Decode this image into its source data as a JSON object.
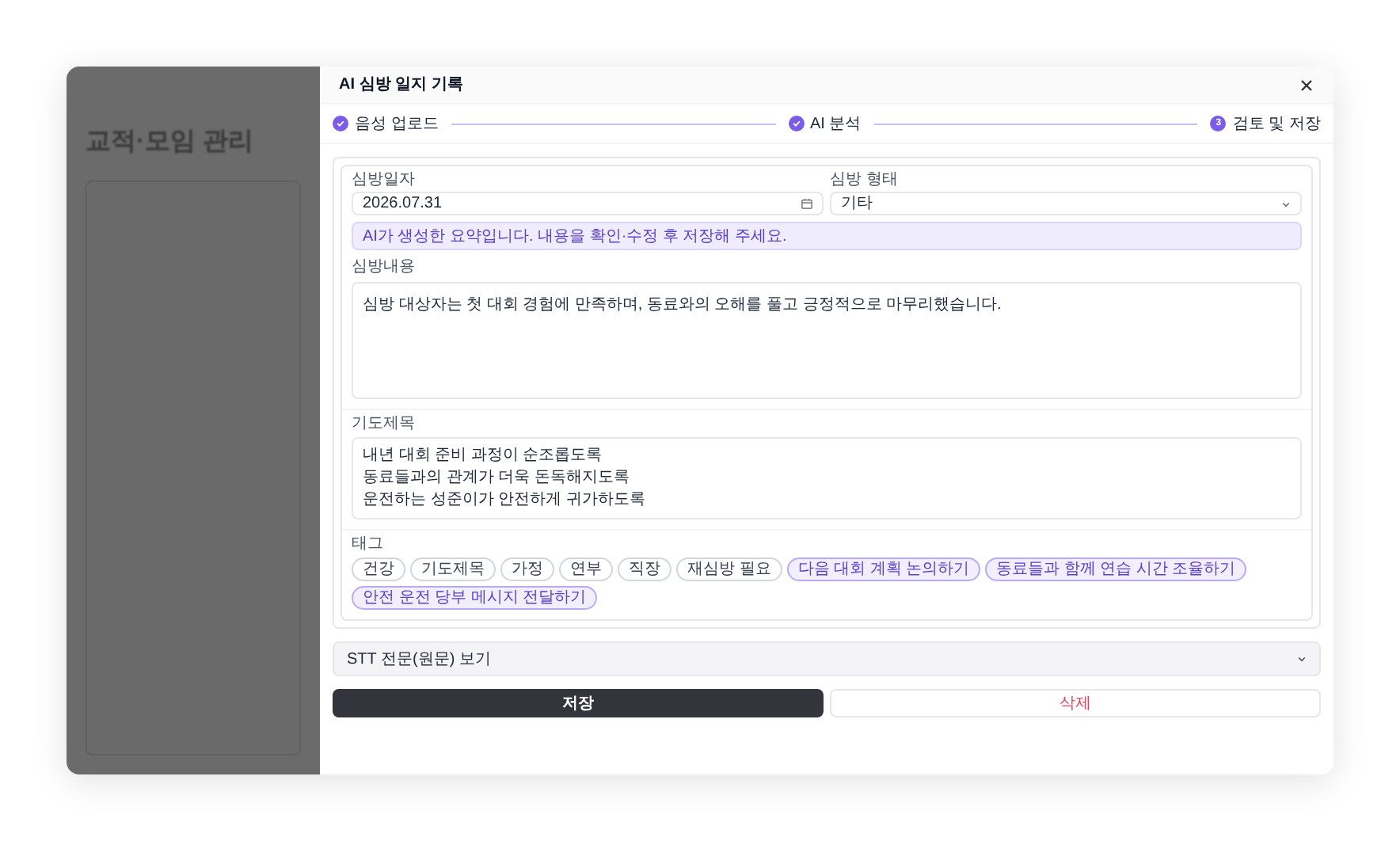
{
  "background_page": {
    "title": "교적·모임 관리"
  },
  "dialog": {
    "title": "AI 심방 일지 기록",
    "steps": [
      {
        "label": "음성 업로드",
        "done": true
      },
      {
        "label": "AI 분석",
        "done": true
      },
      {
        "label": "검토 및 저장",
        "done": false,
        "number": "3"
      }
    ],
    "date_field": {
      "label": "심방일자",
      "value": "2026.07.31"
    },
    "type_field": {
      "label": "심방 형태",
      "value": "기타"
    },
    "notice": "AI가 생성한 요약입니다. 내용을 확인·수정 후 저장해 주세요.",
    "content_field": {
      "label": "심방내용",
      "value": "심방 대상자는 첫 대회 경험에 만족하며, 동료와의 오해를 풀고 긍정적으로 마무리했습니다."
    },
    "prayer_field": {
      "label": "기도제목",
      "lines": [
        "내년 대회 준비 과정이 순조롭도록",
        "동료들과의 관계가 더욱 돈독해지도록",
        "운전하는 성준이가 안전하게 귀가하도록"
      ]
    },
    "tags": {
      "label": "태그",
      "items": [
        {
          "label": "건강",
          "selected": false
        },
        {
          "label": "기도제목",
          "selected": false
        },
        {
          "label": "가정",
          "selected": false
        },
        {
          "label": "연부",
          "selected": false
        },
        {
          "label": "직장",
          "selected": false
        },
        {
          "label": "재심방 필요",
          "selected": false
        },
        {
          "label": "다음 대회 계획 논의하기",
          "selected": true
        },
        {
          "label": "동료들과 함께 연습 시간 조율하기",
          "selected": true
        },
        {
          "label": "안전 운전 당부 메시지 전달하기",
          "selected": true
        }
      ]
    },
    "stt_section": {
      "label": "STT 전문(원문) 보기",
      "expanded": false
    },
    "buttons": {
      "save": "저장",
      "delete": "삭제"
    }
  }
}
